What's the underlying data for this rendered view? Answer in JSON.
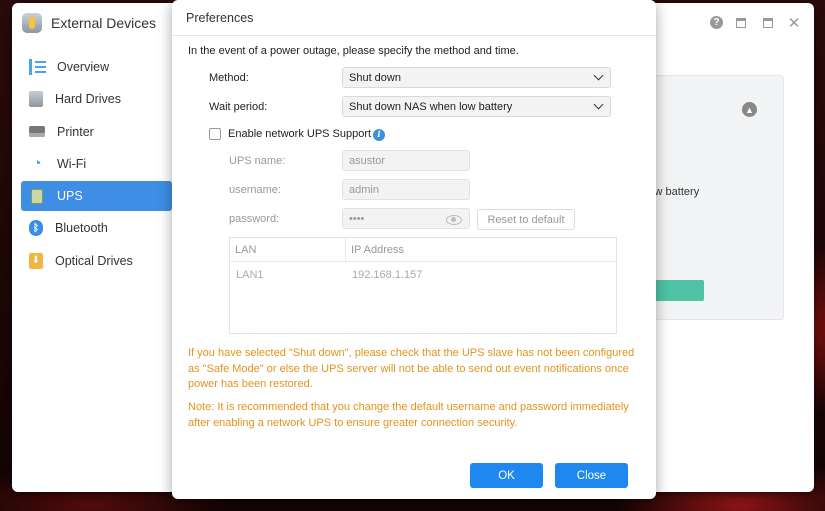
{
  "window": {
    "title": "External Devices",
    "help_glyph": "?",
    "close_glyph": "✕"
  },
  "sidebar": {
    "items": [
      {
        "label": "Overview"
      },
      {
        "label": "Hard Drives"
      },
      {
        "label": "Printer"
      },
      {
        "label": "Wi-Fi"
      },
      {
        "label": "UPS"
      },
      {
        "label": "Bluetooth"
      },
      {
        "label": "Optical Drives"
      }
    ],
    "active": "UPS"
  },
  "background_panel": {
    "partial_text": "low battery"
  },
  "dialog": {
    "title": "Preferences",
    "intro": "In the event of a power outage, please specify the method and time.",
    "method": {
      "label": "Method:",
      "value": "Shut down"
    },
    "wait_period": {
      "label": "Wait period:",
      "value": "Shut down NAS when low battery"
    },
    "network_ups": {
      "label": "Enable network UPS Support",
      "checked": false
    },
    "ups_name": {
      "label": "UPS name:",
      "value": "asustor"
    },
    "username": {
      "label": "username:",
      "value": "admin"
    },
    "password": {
      "label": "password:",
      "value": "••••"
    },
    "reset_button": "Reset to default",
    "table": {
      "headers": [
        "LAN",
        "IP Address"
      ],
      "rows": [
        [
          "LAN1",
          "192.168.1.157"
        ]
      ]
    },
    "warning_1": "If you have selected \"Shut down\", please check that the UPS slave has not been configured as \"Safe Mode\" or else the UPS server will not be able to send out event notifications once power has been restored.",
    "warning_2": "Note: It is recommended that you change the default username and password immediately after enabling a network UPS to ensure greater connection security.",
    "ok_button": "OK",
    "close_button": "Close"
  },
  "colors": {
    "accent": "#1f87f0",
    "sidebar_active": "#3e8ee6",
    "warning": "#e0941c",
    "apply_green": "#4ec3a5"
  }
}
